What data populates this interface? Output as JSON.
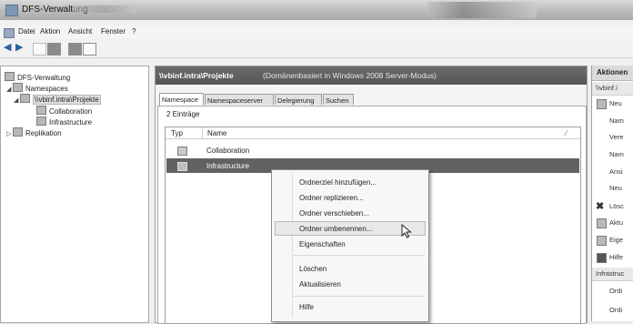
{
  "window": {
    "title": "DFS-Verwaltung"
  },
  "menu": [
    "Datei",
    "Aktion",
    "Ansicht",
    "Fenster",
    "?"
  ],
  "tree": {
    "root": "DFS-Verwaltung",
    "namespaces": "Namespaces",
    "namespace_node": "\\\\vbinf.intra\\Projekte",
    "folders": [
      "Collaboration",
      "Infrastructure"
    ],
    "replication": "Replikation"
  },
  "center": {
    "header_title": "\\\\vbinf.intra\\Projekte",
    "header_subtitle": "(Domänenbasiert in Windows 2008 Server-Modus)",
    "tabs": [
      "Namespace",
      "Namespaceserver",
      "Delegierung",
      "Suchen"
    ],
    "count": "2 Einträge",
    "columns": [
      "Typ",
      "Name"
    ],
    "rows": [
      {
        "name": "Collaboration",
        "highlighted": false
      },
      {
        "name": "Infrastructure",
        "highlighted": true
      }
    ]
  },
  "context_menu": {
    "items": [
      "Ordnerziel hinzufügen...",
      "Ordner replizieren...",
      "Ordner verschieben...",
      "Ordner umbenennen...",
      "Eigenschaften",
      "Löschen",
      "Aktualisieren",
      "Hilfe"
    ],
    "hovered": "Ordner umbenennen..."
  },
  "actions": {
    "title": "Aktionen",
    "section1": "\\\\vbinf.i",
    "items1": [
      "Neu",
      "Nam",
      "Vere",
      "Nam",
      "Ansi",
      "Neu",
      "Lösc",
      "Aktu",
      "Eige",
      "Hilfe"
    ],
    "section2": "Infrastruc",
    "items2": [
      "Ordi",
      "Ordi"
    ]
  },
  "colors": {
    "header_bg": "#5f5f5f",
    "selection": "#626262",
    "menu_bg": "#f7f7f7"
  }
}
